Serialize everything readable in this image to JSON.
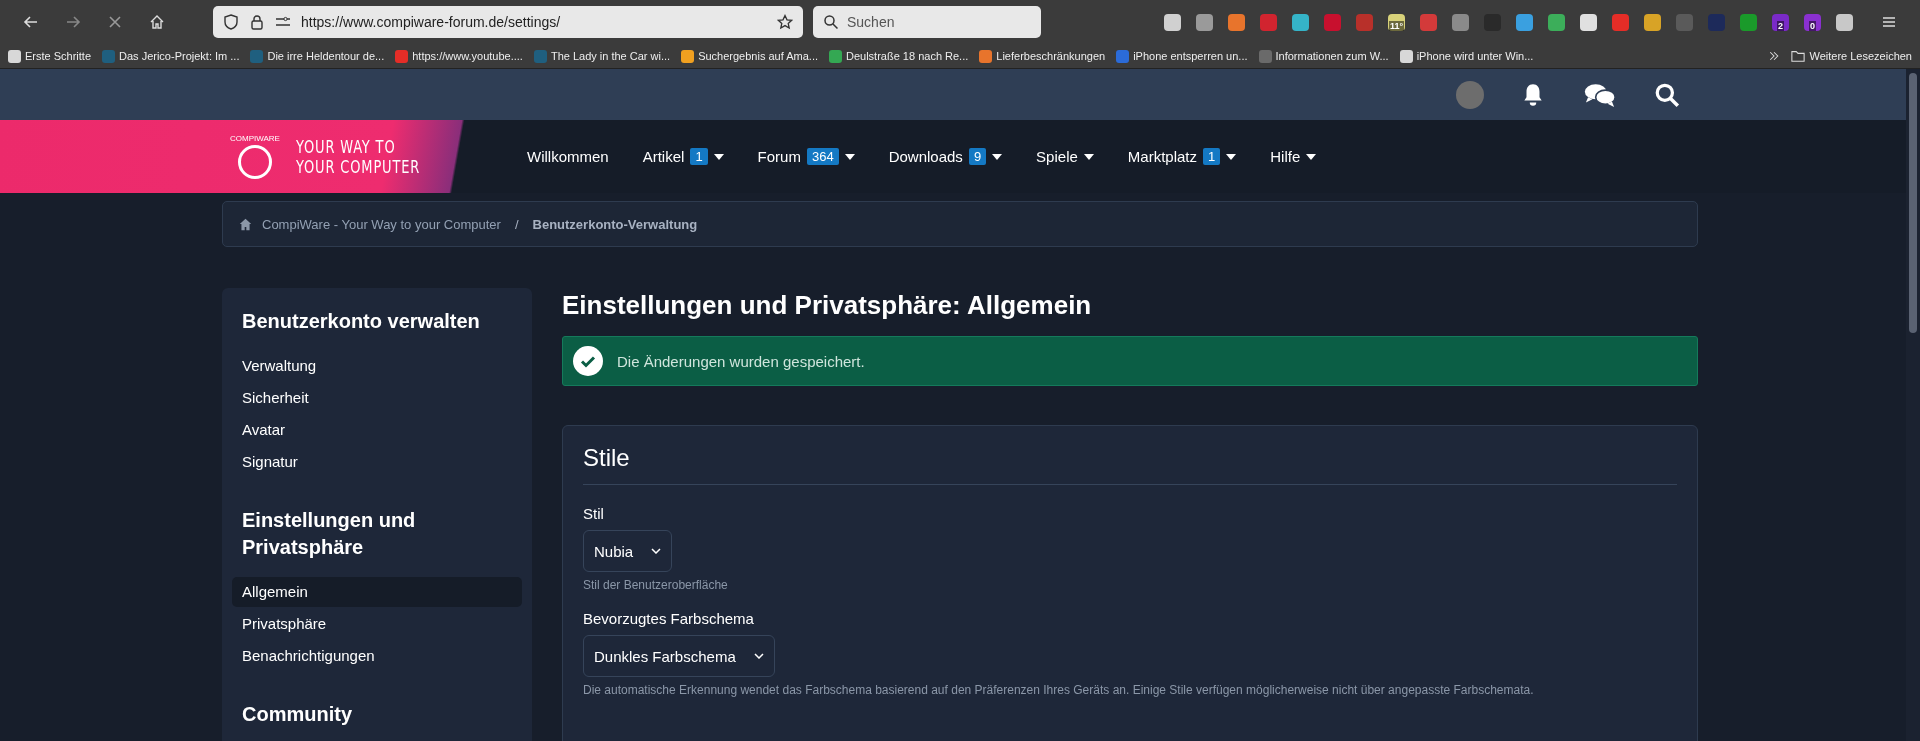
{
  "browser": {
    "url": "https://www.compiware-forum.de/settings/",
    "search_placeholder": "Suchen",
    "extensions": [
      {
        "color": "#d0d0d0"
      },
      {
        "color": "#9a9a9a"
      },
      {
        "color": "#e8742c"
      },
      {
        "color": "#d1242f"
      },
      {
        "color": "#35b4c8"
      },
      {
        "color": "#c8102e"
      },
      {
        "color": "#b8302a"
      },
      {
        "color": "#d8d27a",
        "text": "11°"
      },
      {
        "color": "#d33a3a"
      },
      {
        "color": "#8a8a8a"
      },
      {
        "color": "#2a2a2a"
      },
      {
        "color": "#3aa0e0"
      },
      {
        "color": "#3cae5a"
      },
      {
        "color": "#e0e0e0"
      },
      {
        "color": "#e52d27"
      },
      {
        "color": "#d8a326"
      },
      {
        "color": "#5a5a5a"
      },
      {
        "color": "#1d2a5a"
      },
      {
        "color": "#1a9a2a"
      },
      {
        "color": "#7a2ac8",
        "text": "2"
      },
      {
        "color": "#8a30d0",
        "text": "0"
      },
      {
        "color": "#c8c8c8"
      }
    ],
    "bookmarks": [
      {
        "label": "Erste Schritte",
        "color": "#d8d8d8"
      },
      {
        "label": "Das Jerico-Projekt: Im ...",
        "color": "#1f5f7f"
      },
      {
        "label": "Die irre Heldentour de...",
        "color": "#1f5f7f"
      },
      {
        "label": "https://www.youtube....",
        "color": "#e52d27"
      },
      {
        "label": "The Lady in the Car wi...",
        "color": "#1f5f7f"
      },
      {
        "label": "Suchergebnis auf Ama...",
        "color": "#f0a020"
      },
      {
        "label": "Deulstraße 18 nach Re...",
        "color": "#34a853"
      },
      {
        "label": "Lieferbeschränkungen",
        "color": "#e8742c"
      },
      {
        "label": "iPhone entsperren un...",
        "color": "#2b6bd8"
      },
      {
        "label": "Informationen zum W...",
        "color": "#6a6a6a"
      },
      {
        "label": "iPhone wird unter Win...",
        "color": "#d8d8d8"
      }
    ],
    "more_bookmarks": "Weitere Lesezeichen"
  },
  "site": {
    "logo": {
      "line_1": "YOUR WAY TO",
      "line_2": "YOUR COMPUTER",
      "mark": "COMPIWARE"
    },
    "nav": [
      {
        "label": "Willkommen",
        "dropdown": false
      },
      {
        "label": "Artikel",
        "badge": "1",
        "dropdown": true
      },
      {
        "label": "Forum",
        "badge": "364",
        "dropdown": true
      },
      {
        "label": "Downloads",
        "badge": "9",
        "dropdown": true
      },
      {
        "label": "Spiele",
        "dropdown": true
      },
      {
        "label": "Marktplatz",
        "badge": "1",
        "dropdown": true
      },
      {
        "label": "Hilfe",
        "dropdown": true
      }
    ],
    "breadcrumb_separator": "/",
    "breadcrumb": [
      {
        "label": "CompiWare - Your Way to your Computer",
        "current": false
      },
      {
        "label": "Benutzerkonto-Verwaltung",
        "current": true
      }
    ],
    "sidebar": [
      {
        "title": "Benutzerkonto verwalten",
        "items": [
          {
            "label": "Verwaltung",
            "selected": false
          },
          {
            "label": "Sicherheit",
            "selected": false
          },
          {
            "label": "Avatar",
            "selected": false
          },
          {
            "label": "Signatur",
            "selected": false
          }
        ]
      },
      {
        "title": "Einstellungen und Privatsphäre",
        "items": [
          {
            "label": "Allgemein",
            "selected": true
          },
          {
            "label": "Privatsphäre",
            "selected": false
          },
          {
            "label": "Benachrichtigungen",
            "selected": false
          }
        ]
      },
      {
        "title": "Community"
      }
    ],
    "page_title": "Einstellungen und Privatsphäre: Allgemein",
    "notice": "Die Änderungen wurden gespeichert.",
    "card": {
      "title": "Stile",
      "fields": [
        {
          "label": "Stil",
          "value": "Nubia",
          "hint": "Stil der Benutzeroberfläche"
        },
        {
          "label": "Bevorzugtes Farbschema",
          "value": "Dunkles Farbschema",
          "hint": "Die automatische Erkennung wendet das Farbschema basierend auf den Präferenzen Ihres Geräts an. Einige Stile verfügen möglicherweise nicht über angepasste Farbschemata."
        }
      ]
    }
  }
}
